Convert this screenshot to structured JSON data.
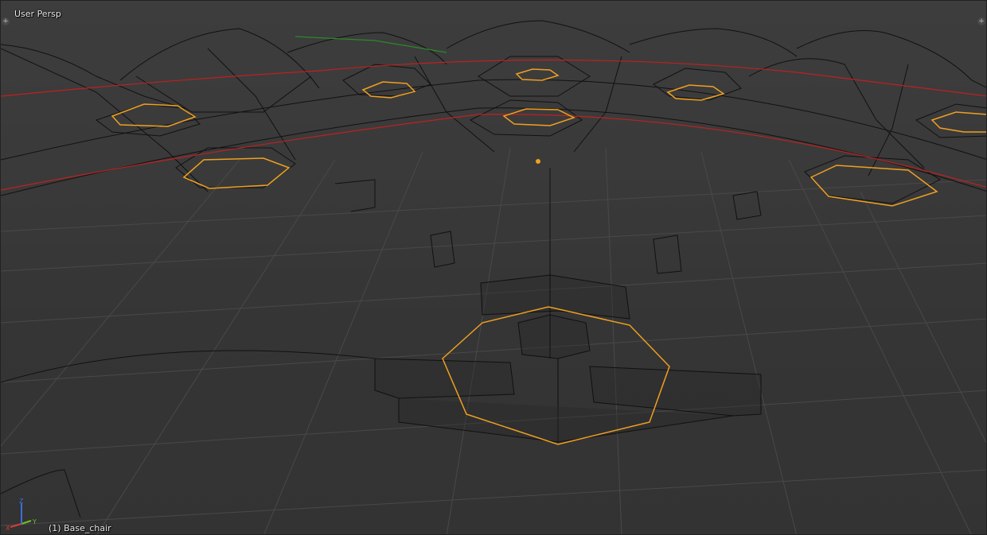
{
  "viewport": {
    "view_label": "User Persp",
    "object_label": "(1) Base_chair",
    "corner_widget": "+"
  },
  "axes": {
    "x_label": "X",
    "y_label": "Y",
    "z_label": "Z",
    "x_color": "#d63b3b",
    "y_color": "#6fbf2a",
    "z_color": "#3b6fd6"
  },
  "colors": {
    "wire": "#0e0e0e",
    "selected_wire": "#f0a020",
    "grid_line": "#4a4a4a",
    "x_axis_line": "#c02020",
    "y_axis_line": "#2a8a2a",
    "origin_dot": "#f0a020"
  },
  "icons": {
    "corner_widget_icon": "plus-icon",
    "axis_gizmo_icon": "axis-gizmo-icon",
    "origin_icon": "origin-dot-icon"
  }
}
